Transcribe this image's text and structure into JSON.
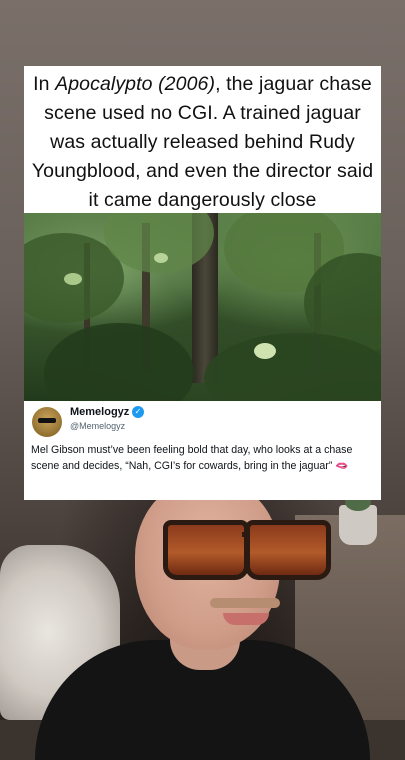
{
  "caption": {
    "prefix": "In ",
    "title_italic": "Apocalypto (2006)",
    "suffix": ", the jaguar chase scene used no CGI. A trained jaguar was actually released behind Rudy Youngblood, and even the director said it came dangerously close"
  },
  "tweet": {
    "name": "Memelogyz",
    "handle": "@Memelogyz",
    "body": "Mel Gibson must’ve been feeling bold that day, who looks at a chase scene and decides, “Nah, CGI’s for cowards, bring in the jaguar”",
    "emoji": "🫦",
    "verified_color": "#1d9bf0"
  },
  "icons": {
    "verified": "verified-badge-icon"
  }
}
